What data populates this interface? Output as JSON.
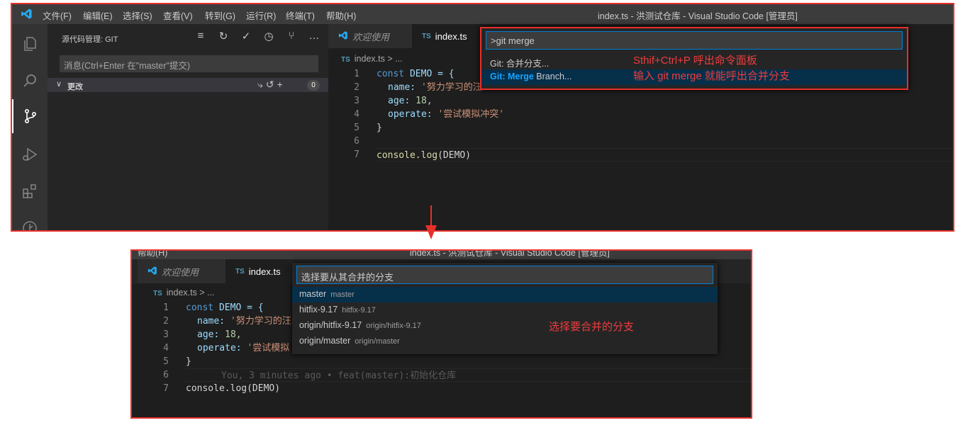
{
  "top": {
    "menu": [
      "文件(F)",
      "编辑(E)",
      "选择(S)",
      "查看(V)",
      "转到(G)",
      "运行(R)",
      "终端(T)",
      "帮助(H)"
    ],
    "window_title": "index.ts - 洪测试仓库 - Visual Studio Code [管理员]",
    "sidebar": {
      "title": "源代码管理: GIT",
      "message_placeholder": "消息(Ctrl+Enter 在\"master\"提交)",
      "changes_label": "更改",
      "changes_count": "0"
    },
    "tabs": [
      {
        "label": "欢迎使用"
      },
      {
        "label": "index.ts",
        "badge": "TS"
      }
    ],
    "breadcrumb": "index.ts > ...",
    "line_numbers": [
      "1",
      "2",
      "3",
      "4",
      "5",
      "6",
      "7"
    ],
    "code": {
      "l1_kw": "const",
      "l1_name": " DEMO = {",
      "l2_key": "name:",
      "l2_val": " '努力学习的汪",
      "l3_key": "age:",
      "l3_val": " 18,",
      "l4_key": "operate:",
      "l4_val": " '尝试模拟冲突'",
      "l5": "}",
      "l7_fn": "console.log",
      "l7_rest": "(DEMO)"
    },
    "palette": {
      "input": ">git merge",
      "item1": "Git: 合并分支...",
      "item2_prefix": "Git: Merge",
      "item2_suffix": " Branch..."
    },
    "note1": "Sthif+Ctrl+P 呼出命令面板",
    "note2": "输入 git merge 就能呼出合并分支"
  },
  "bottom": {
    "title_left": "帮助(H)",
    "title_center": "index.ts - 洪测试仓库 - Visual Studio Code [管理员]",
    "tabs": [
      {
        "label": "欢迎使用"
      },
      {
        "label": "index.ts",
        "badge": "TS"
      }
    ],
    "breadcrumb": "index.ts > ...",
    "line_numbers": [
      "1",
      "2",
      "3",
      "4",
      "5",
      "6",
      "7"
    ],
    "code": {
      "l1_kw": "const",
      "l1_name": " DEMO = {",
      "l2_key": "name:",
      "l2_val": " '努力学习的汪",
      "l3_key": "age:",
      "l3_val": " 18,",
      "l4_key": "operate:",
      "l4_val": " '尝试模拟",
      "l5": "}",
      "l6_blame": "You, 3 minutes ago • feat(master):初始化仓库",
      "l7": "console.log(DEMO)"
    },
    "palette": {
      "placeholder": "选择要从其合并的分支",
      "branches": [
        {
          "name": "master",
          "desc": "master"
        },
        {
          "name": "hitfix-9.17",
          "desc": "hitfix-9.17"
        },
        {
          "name": "origin/hitfix-9.17",
          "desc": "origin/hitfix-9.17"
        },
        {
          "name": "origin/master",
          "desc": "origin/master"
        }
      ]
    },
    "note": "选择要合并的分支"
  },
  "colors": {
    "annotation": "#e8302b",
    "accent": "#007acc",
    "editor_bg": "#1e1e1e"
  },
  "icons": [
    "vscode-logo-icon",
    "explorer-icon",
    "search-icon",
    "source-control-icon",
    "run-debug-icon",
    "extensions-icon",
    "git-graph-icon"
  ]
}
